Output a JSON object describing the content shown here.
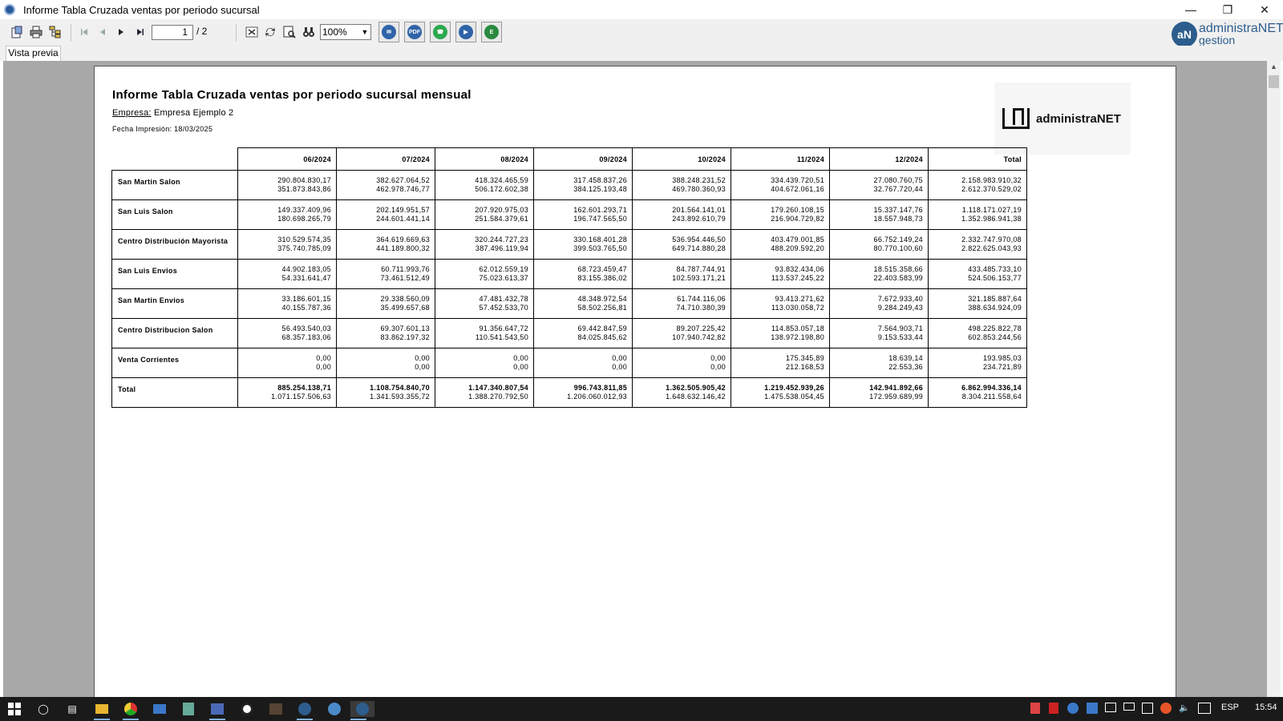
{
  "window": {
    "title": "Informe Tabla Cruzada ventas por periodo sucursal",
    "controls": [
      "minimize-icon",
      "restore-icon",
      "close-icon"
    ]
  },
  "toolbar": {
    "page_current": "1",
    "page_total": "/ 2",
    "zoom": "100%",
    "brand_line1": "administraNET",
    "brand_line2": "gestion",
    "brand_mark": "aN"
  },
  "tabs": [
    {
      "label": "Vista previa"
    }
  ],
  "report": {
    "title": "Informe Tabla Cruzada ventas por periodo sucursal mensual",
    "empresa_label": "Empresa:",
    "empresa_value": "Empresa Ejemplo 2",
    "fecha": "Fecha Impresión: 18/03/2025",
    "logo_text": "administraNET",
    "columns": [
      "06/2024",
      "07/2024",
      "08/2024",
      "09/2024",
      "10/2024",
      "11/2024",
      "12/2024",
      "Total"
    ],
    "rows": [
      {
        "label": "San Martin Salon",
        "cells": [
          [
            "290.804.830,17",
            "351.873.843,86"
          ],
          [
            "382.627.064,52",
            "462.978.746,77"
          ],
          [
            "418.324.465,59",
            "506.172.602,38"
          ],
          [
            "317.458.837,26",
            "384.125.193,48"
          ],
          [
            "388.248.231,52",
            "469.780.360,93"
          ],
          [
            "334.439.720,51",
            "404.672.061,16"
          ],
          [
            "27.080.760,75",
            "32.767.720,44"
          ],
          [
            "2.158.983.910,32",
            "2.612.370.529,02"
          ]
        ]
      },
      {
        "label": "San Luis Salon",
        "cells": [
          [
            "149.337.409,96",
            "180.698.265,79"
          ],
          [
            "202.149.951,57",
            "244.601.441,14"
          ],
          [
            "207.920.975,03",
            "251.584.379,61"
          ],
          [
            "162.601.293,71",
            "196.747.565,50"
          ],
          [
            "201.564.141,01",
            "243.892.610,79"
          ],
          [
            "179.260.108,15",
            "216.904.729,82"
          ],
          [
            "15.337.147,76",
            "18.557.948,73"
          ],
          [
            "1.118.171.027,19",
            "1.352.986.941,38"
          ]
        ]
      },
      {
        "label": "Centro Distribución Mayorista",
        "cells": [
          [
            "310.529.574,35",
            "375.740.785,09"
          ],
          [
            "364.619.669,63",
            "441.189.800,32"
          ],
          [
            "320.244.727,23",
            "387.496.119,94"
          ],
          [
            "330.168.401,28",
            "399.503.765,50"
          ],
          [
            "536.954.446,50",
            "649.714.880,28"
          ],
          [
            "403.479.001,85",
            "488.209.592,20"
          ],
          [
            "66.752.149,24",
            "80.770.100,60"
          ],
          [
            "2.332.747.970,08",
            "2.822.625.043,93"
          ]
        ]
      },
      {
        "label": "San Luis Envios",
        "cells": [
          [
            "44.902.183,05",
            "54.331.641,47"
          ],
          [
            "60.711.993,76",
            "73.461.512,49"
          ],
          [
            "62.012.559,19",
            "75.023.613,37"
          ],
          [
            "68.723.459,47",
            "83.155.386,02"
          ],
          [
            "84.787.744,91",
            "102.593.171,21"
          ],
          [
            "93.832.434,06",
            "113.537.245,22"
          ],
          [
            "18.515.358,66",
            "22.403.583,99"
          ],
          [
            "433.485.733,10",
            "524.506.153,77"
          ]
        ]
      },
      {
        "label": "San Martin Envios",
        "cells": [
          [
            "33.186.601,15",
            "40.155.787,36"
          ],
          [
            "29.338.560,09",
            "35.499.657,68"
          ],
          [
            "47.481.432,78",
            "57.452.533,70"
          ],
          [
            "48.348.972,54",
            "58.502.256,81"
          ],
          [
            "61.744.116,06",
            "74.710.380,39"
          ],
          [
            "93.413.271,62",
            "113.030.058,72"
          ],
          [
            "7.672.933,40",
            "9.284.249,43"
          ],
          [
            "321.185.887,64",
            "388.634.924,09"
          ]
        ]
      },
      {
        "label": "Centro Distribucion Salon",
        "cells": [
          [
            "56.493.540,03",
            "68.357.183,06"
          ],
          [
            "69.307.601,13",
            "83.862.197,32"
          ],
          [
            "91.356.647,72",
            "110.541.543,50"
          ],
          [
            "69.442.847,59",
            "84.025.845,62"
          ],
          [
            "89.207.225,42",
            "107.940.742,82"
          ],
          [
            "114.853.057,18",
            "138.972.198,80"
          ],
          [
            "7.564.903,71",
            "9.153.533,44"
          ],
          [
            "498.225.822,78",
            "602.853.244,56"
          ]
        ]
      },
      {
        "label": "Venta Corrientes",
        "cells": [
          [
            "0,00",
            "0,00"
          ],
          [
            "0,00",
            "0,00"
          ],
          [
            "0,00",
            "0,00"
          ],
          [
            "0,00",
            "0,00"
          ],
          [
            "0,00",
            "0,00"
          ],
          [
            "175.345,89",
            "212.168,53"
          ],
          [
            "18.639,14",
            "22.553,36"
          ],
          [
            "193.985,03",
            "234.721,89"
          ]
        ]
      },
      {
        "label": "Total",
        "cells": [
          [
            "885.254.138,71",
            "1.071.157.506,63"
          ],
          [
            "1.108.754.840,70",
            "1.341.593.355,72"
          ],
          [
            "1.147.340.807,54",
            "1.388.270.792,50"
          ],
          [
            "996.743.811,85",
            "1.206.060.012,93"
          ],
          [
            "1.362.505.905,42",
            "1.648.632.146,42"
          ],
          [
            "1.219.452.939,26",
            "1.475.538.054,45"
          ],
          [
            "142.941.892,66",
            "172.959.689,99"
          ],
          [
            "6.862.994.336,14",
            "8.304.211.558,64"
          ]
        ]
      }
    ]
  },
  "taskbar": {
    "lang": "ESP",
    "time": "15:54"
  }
}
